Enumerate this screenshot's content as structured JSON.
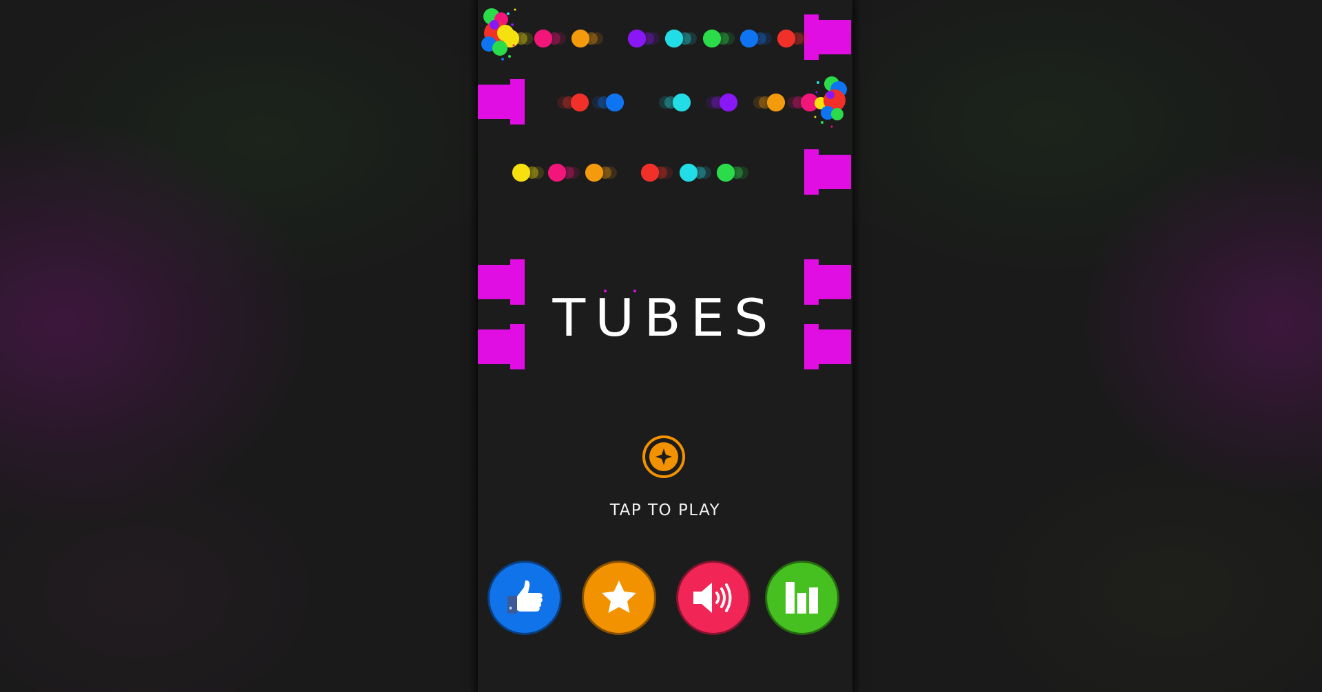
{
  "game": {
    "title": "TUBES",
    "tap_label": "TAP TO PLAY"
  },
  "colors": {
    "pipe": "#e10ee3",
    "background": "#1c1c1d",
    "play_button": "#f39200",
    "like_button": "#1173ea",
    "rate_button": "#f39200",
    "sound_button": "#f22656",
    "leaderboard_button": "#46c020"
  },
  "balls": [
    {
      "color": "#f6e10f",
      "dir": "l"
    },
    {
      "color": "#f2157a",
      "dir": "l"
    },
    {
      "color": "#f39a0d",
      "dir": "l"
    },
    {
      "color": "#8a17f5",
      "dir": "l"
    },
    {
      "color": "#22dde6",
      "dir": "l"
    },
    {
      "color": "#2bdc4a",
      "dir": "l"
    },
    {
      "color": "#0f74f2",
      "dir": "l"
    },
    {
      "color": "#f2302a",
      "dir": "l"
    },
    {
      "color": "#f2302a",
      "dir": "r"
    },
    {
      "color": "#0f74f2",
      "dir": "r"
    },
    {
      "color": "#22dde6",
      "dir": "r"
    },
    {
      "color": "#8a17f5",
      "dir": "r"
    },
    {
      "color": "#f39a0d",
      "dir": "r"
    },
    {
      "color": "#f2157a",
      "dir": "r"
    },
    {
      "color": "#f6e10f",
      "dir": "l"
    },
    {
      "color": "#f2157a",
      "dir": "l"
    },
    {
      "color": "#f39a0d",
      "dir": "l"
    },
    {
      "color": "#f2302a",
      "dir": "l"
    },
    {
      "color": "#22dde6",
      "dir": "l"
    },
    {
      "color": "#2bdc4a",
      "dir": "l"
    }
  ],
  "menu": [
    {
      "name": "like-button",
      "icon": "thumbs-up-icon"
    },
    {
      "name": "rate-button",
      "icon": "star-icon"
    },
    {
      "name": "sound-button",
      "icon": "speaker-icon"
    },
    {
      "name": "leaderboard-button",
      "icon": "bar-chart-icon"
    }
  ]
}
